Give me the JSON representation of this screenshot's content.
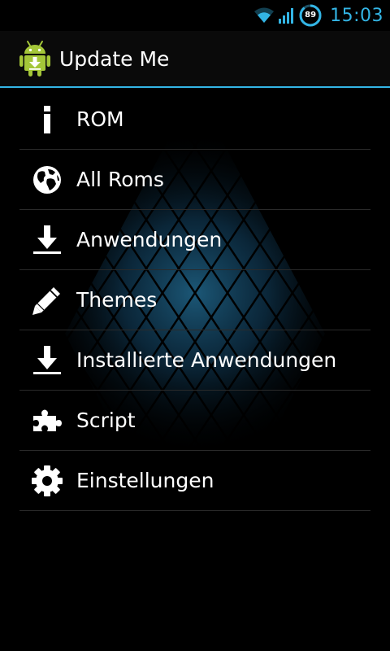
{
  "status_bar": {
    "time": "15:03",
    "battery_level": "89",
    "wifi_icon": "wifi-icon",
    "signal_icon": "cell-signal-icon",
    "accent_color": "#33b5e5"
  },
  "action_bar": {
    "title": "Update Me",
    "icon": "android-update-icon"
  },
  "menu": {
    "items": [
      {
        "label": "ROM",
        "icon": "info-icon"
      },
      {
        "label": "All Roms",
        "icon": "globe-icon"
      },
      {
        "label": "Anwendungen",
        "icon": "download-icon"
      },
      {
        "label": "Themes",
        "icon": "pencil-icon"
      },
      {
        "label": "Installierte Anwendungen",
        "icon": "download-icon"
      },
      {
        "label": "Script",
        "icon": "puzzle-icon"
      },
      {
        "label": "Einstellungen",
        "icon": "gear-icon"
      }
    ]
  }
}
